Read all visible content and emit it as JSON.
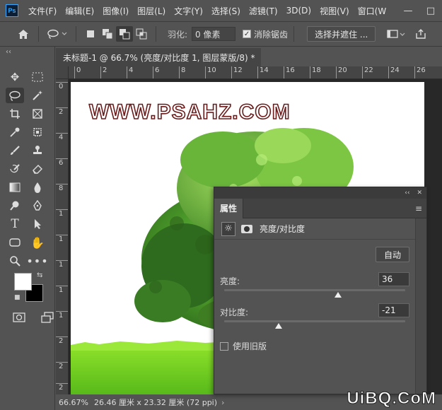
{
  "app": {
    "logo": "Ps",
    "menu": [
      "文件(F)",
      "编辑(E)",
      "图像(I)",
      "图层(L)",
      "文字(Y)",
      "选择(S)",
      "滤镜(T)",
      "3D(D)",
      "视图(V)",
      "窗口(W"
    ],
    "window_controls": {
      "minimize": "—",
      "maximize": "□"
    }
  },
  "options": {
    "home": "⌂",
    "lasso": "ʘ",
    "feather_label": "羽化:",
    "feather_value": "0 像素",
    "antialias_label": "消除锯齿",
    "antialias_checked": true,
    "select_mask": "选择并遮住 ..."
  },
  "document": {
    "tab_title": "未标题-1 @ 66.7% (亮度/对比度 1, 图层蒙版/8) *",
    "close": "×",
    "ruler_top": [
      "0",
      "2",
      "4",
      "6",
      "8",
      "10",
      "12",
      "14",
      "16",
      "18",
      "20",
      "22",
      "24",
      "26"
    ],
    "ruler_left": [
      "0",
      "2",
      "4",
      "6",
      "8",
      "1",
      "1",
      "1",
      "1",
      "1",
      "2",
      "2",
      "2"
    ],
    "canvas_watermark": "WWW.PSAHZ.COM"
  },
  "status": {
    "zoom": "66.67%",
    "doc_info": "26.46 厘米 x 23.32 厘米 (72 ppi)",
    "arrow": "›"
  },
  "page_watermark": "UiBQ.CoM",
  "properties": {
    "collapse": "‹‹",
    "close": "✕",
    "tab_label": "属性",
    "menu": "≡",
    "adjustment_title": "亮度/对比度",
    "auto_label": "自动",
    "brightness_label": "亮度:",
    "brightness_value": "36",
    "brightness_fraction": 0.63,
    "contrast_label": "对比度:",
    "contrast_value": "-21",
    "contrast_fraction": 0.3,
    "use_legacy_label": "使用旧版",
    "use_legacy_checked": false
  },
  "colors": {
    "foreground": "#ffffff",
    "background": "#000000",
    "accent": "#31a8ff",
    "watermark_stroke": "#6b1a1a"
  }
}
